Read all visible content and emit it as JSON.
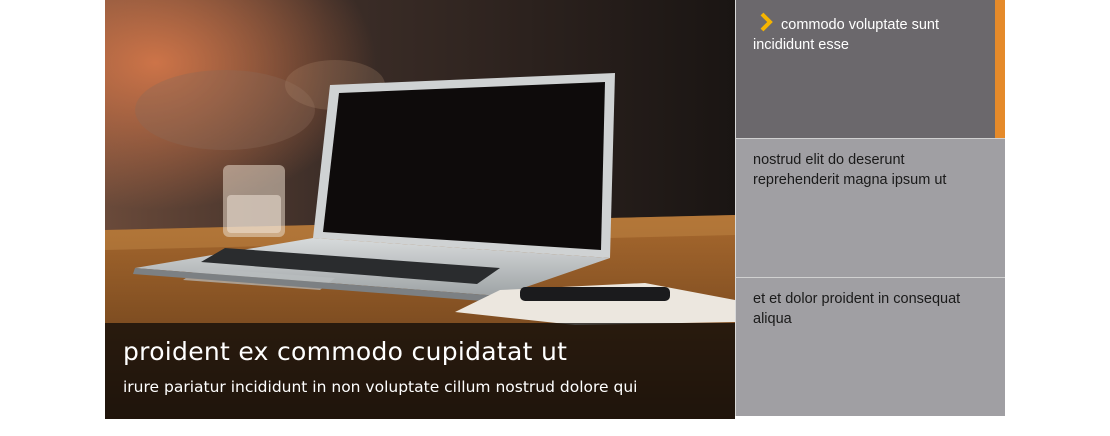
{
  "colors": {
    "accent": "#e58a2a",
    "chevron": "#f5b400",
    "active_tab_bg": "#6b686c",
    "inactive_tab_bg": "#a09fa3"
  },
  "hero": {
    "image_icon": "laptop-photo",
    "title": "proident ex commodo cupidatat ut",
    "subtitle": "irure pariatur incididunt in non voluptate cillum nostrud dolore qui"
  },
  "tabs": [
    {
      "label": "commodo voluptate sunt incididunt esse",
      "active": true,
      "icon": "chevron-right-icon"
    },
    {
      "label": "nostrud elit do deserunt reprehenderit magna ipsum ut",
      "active": false
    },
    {
      "label": "et et dolor proident in consequat aliqua",
      "active": false
    }
  ]
}
